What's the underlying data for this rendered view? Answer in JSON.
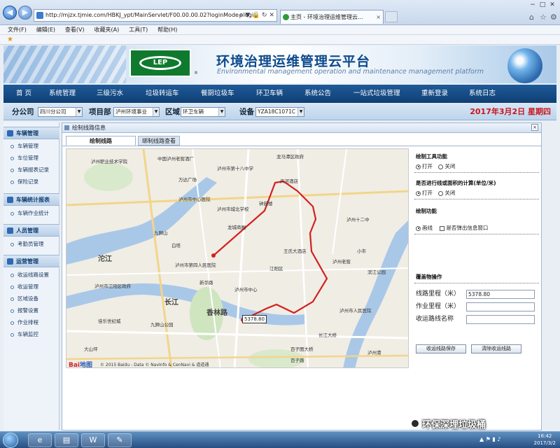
{
  "browser": {
    "url": "http://mjzx.tjmie.com/HBKJ_ypt/MainServlet/F00.00.00.02?loginMode=login",
    "tab_title": "主页 - 环境治理运维管理云...",
    "tools": "ρ ▼ 🔒 ↻ ✕",
    "menu": [
      "文件(F)",
      "编辑(E)",
      "查看(V)",
      "收藏夹(A)",
      "工具(T)",
      "帮助(H)"
    ]
  },
  "header": {
    "title_cn": "环境治理运维管理云平台",
    "title_en": "Environmental management operation and maintenance management platform",
    "logo_text": "LEP"
  },
  "nav": [
    "首 页",
    "系统管理",
    "三级污水",
    "垃圾转运车",
    "餐厨垃圾车",
    "环卫车辆",
    "系统公告",
    "一站式垃圾管理",
    "重新登录",
    "系统日志"
  ],
  "filters": {
    "branch_label": "分公司",
    "branch_value": "四川分公司",
    "dept_label": "项目部",
    "dept_value": "泸州环境事业",
    "area_label": "区域",
    "area_value": "环卫车辆",
    "device_label": "设备",
    "device_value": "YZA18C1071C",
    "date": "2017年3月2日  星期四"
  },
  "sidebar": {
    "sections": [
      {
        "title": "车辆管理",
        "items": [
          "车辆管理",
          "车位管理",
          "车辆报表记录",
          "保险记录"
        ]
      },
      {
        "title": "车辆统计报表",
        "items": [
          "车辆作业统计"
        ]
      },
      {
        "title": "人员管理",
        "items": [
          "考勤员管理"
        ]
      },
      {
        "title": "运营管理",
        "items": [
          "收运线路设置",
          "收运管理",
          "区域设备",
          "报警设置",
          "作业排程",
          "车辆监控"
        ]
      }
    ]
  },
  "panel": {
    "title": "绘制线路信息",
    "tabs": [
      "绘制线路",
      "绑制线路查看"
    ],
    "close": "×"
  },
  "map": {
    "distance_badge": "5378.80",
    "logo": "Bai",
    "logo2": "地图",
    "copyright": "© 2015 Baidu - Data © NavInfo & CenNavi & 道道通",
    "labels": [
      "泸州职业技术学院",
      "中国泸州老窖酒厂",
      "龙马潭区政府",
      "泸州市第十八中学",
      "沱江",
      "长江",
      "泸州市中心医院",
      "天河酒店",
      "万达广场",
      "泸州市城北学校",
      "龙城商圈",
      "九狮山",
      "钟鼓楼",
      "白塔",
      "泸州市第四人民医院",
      "王氏大酒店",
      "江阳区",
      "小市",
      "泸州老窖",
      "滨江公园",
      "泸州十二中",
      "泸州市江阳区政府",
      "百子图大桥",
      "泸州市人民医院",
      "佳乐世纪城",
      "百子路",
      "大山坪",
      "香林路",
      "泸州市中心",
      "九狮山公园",
      "新华路",
      "长江大桥",
      "泸州港"
    ]
  },
  "settings": {
    "tool_title": "绘制工具功能",
    "tool_on": "打开",
    "tool_off": "关闭",
    "calc_title": "是否进行线或面积的计算(单位/米)",
    "calc_on": "打开",
    "calc_off": "关闭",
    "draw_title": "绘制功能",
    "draw_line": "画线",
    "draw_window": "是否弹出信息窗口",
    "cover_title": "覆盖物操作",
    "route_km_label": "线路里程（米）",
    "route_km_value": "5378.80",
    "work_km_label": "作业里程（米）",
    "work_km_value": "",
    "route_name_label": "收运路线名称",
    "route_name_value": "",
    "save_btn": "收运线路保存",
    "clear_btn": "清除收运线路"
  },
  "watermark": "环保深埋垃圾桶",
  "taskbar": {
    "time": "16:42",
    "date": "2017/3/2"
  }
}
